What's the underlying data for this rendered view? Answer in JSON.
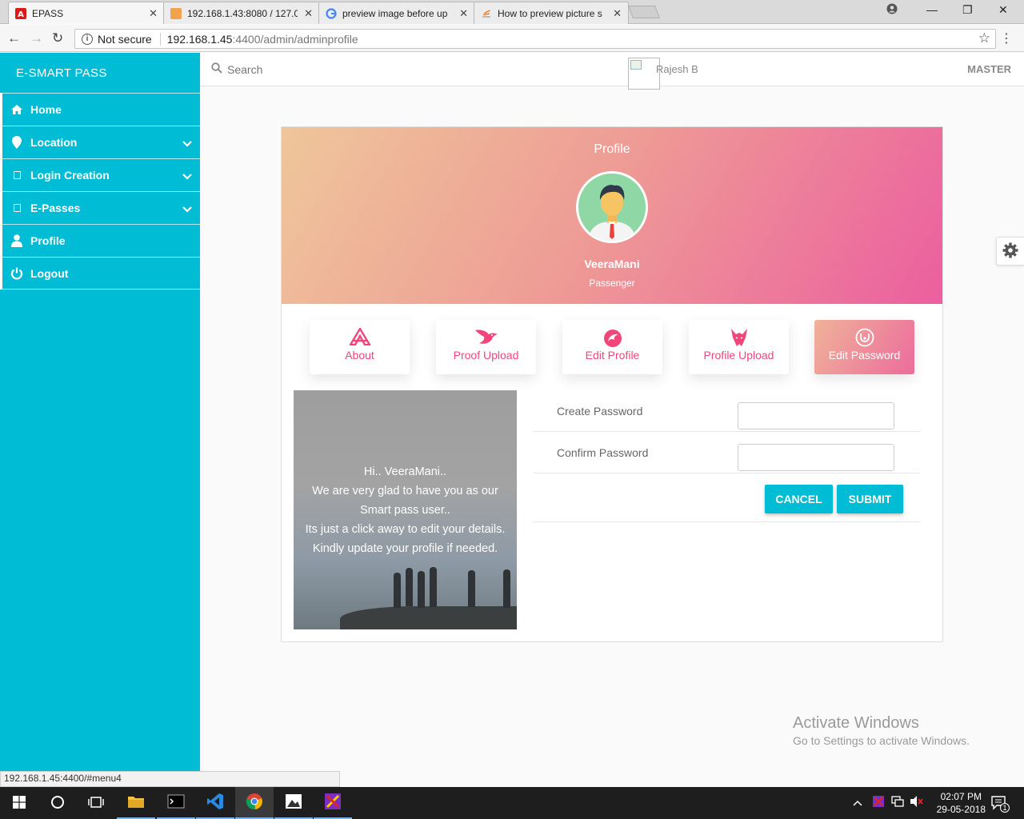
{
  "browser": {
    "tabs": [
      {
        "title": "EPASS",
        "icon": "angular-icon",
        "active": true
      },
      {
        "title": "192.168.1.43:8080 / 127.0",
        "icon": "phpmyadmin-icon",
        "active": false
      },
      {
        "title": "preview image before up",
        "icon": "google-icon",
        "active": false
      },
      {
        "title": "How to preview picture s",
        "icon": "stackoverflow-icon",
        "active": false
      }
    ],
    "security_label": "Not secure",
    "url_host": "192.168.1.45",
    "url_path": ":4400/admin/adminprofile",
    "status_url": "192.168.1.45:4400/#menu4"
  },
  "sidebar": {
    "brand": "E-SMART PASS",
    "items": [
      {
        "label": "Home",
        "icon": "home-icon"
      },
      {
        "label": "Location",
        "icon": "location-pin-icon"
      },
      {
        "label": "Login Creation",
        "icon": "square-icon"
      },
      {
        "label": "E-Passes",
        "icon": "square-icon"
      },
      {
        "label": "Profile",
        "icon": "user-icon"
      },
      {
        "label": "Logout",
        "icon": "power-icon"
      }
    ]
  },
  "topbar": {
    "search_placeholder": "Search",
    "user_name": "Rajesh B",
    "role_label": "MASTER"
  },
  "profile": {
    "title": "Profile",
    "name": "VeeraMani",
    "role": "Passenger",
    "tabs": [
      {
        "label": "About",
        "icon": "about-icon"
      },
      {
        "label": "Proof Upload",
        "icon": "bird-icon"
      },
      {
        "label": "Edit Profile",
        "icon": "phoenix-icon"
      },
      {
        "label": "Profile Upload",
        "icon": "wolf-icon"
      },
      {
        "label": "Edit Password",
        "icon": "lock-circle-icon",
        "active": true
      }
    ],
    "hero_lines": [
      "Hi.. VeeraMani..",
      "We are very glad to have you as our",
      "Smart pass user..",
      "Its just a click away to edit your details.",
      "Kindly update your profile if needed."
    ],
    "form": {
      "create_label": "Create Password",
      "confirm_label": "Confirm Password",
      "create_value": "",
      "confirm_value": "",
      "cancel_label": "CANCEL",
      "submit_label": "SUBMIT"
    }
  },
  "watermark": {
    "line1": "Activate Windows",
    "line2": "Go to Settings to activate Windows."
  },
  "taskbar": {
    "time": "02:07 PM",
    "date": "29-05-2018",
    "notification_count": "1"
  },
  "colors": {
    "accent": "#00bcd4",
    "pink": "#f2457a",
    "gradient_start": "#efc69b",
    "gradient_end": "#ec5f9f"
  }
}
